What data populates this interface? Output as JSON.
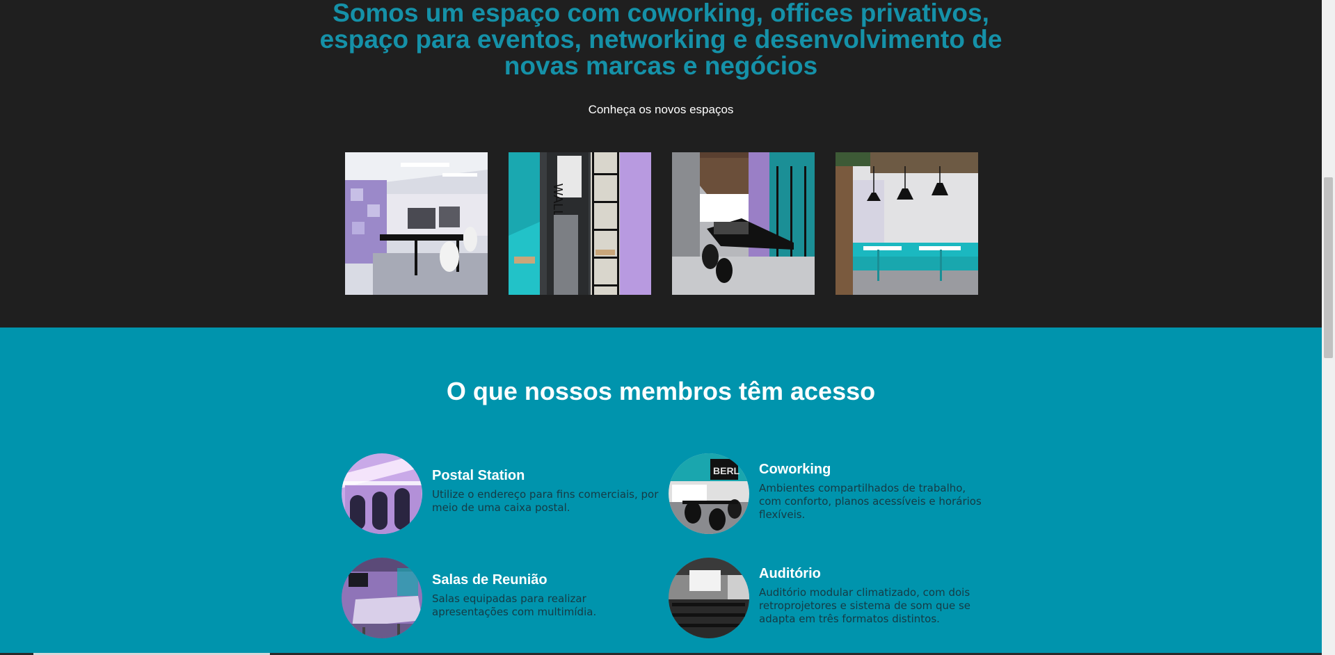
{
  "hero": {
    "title": "Somos um espaço com coworking, offices privativos, espaço para eventos, networking e desenvolvimento de novas marcas e negócios",
    "subtitle": "Conheça os novos espaços"
  },
  "members": {
    "title": "O que nossos membros têm acesso",
    "features": [
      {
        "title": "Postal Station",
        "description": "Utilize o endereço para fins comerciais, por meio de uma caixa postal."
      },
      {
        "title": "Coworking",
        "description": "Ambientes compartilhados de trabalho, com conforto, planos acessíveis e horários flexíveis."
      },
      {
        "title": "Salas de Reunião",
        "description": "Salas equipadas para realizar apresentações com multimídia."
      },
      {
        "title": "Auditório",
        "description": "Auditório modular climatizado, com dois retroprojetores e sistema de som que se adapta em três formatos distintos."
      }
    ]
  },
  "colors": {
    "dark_background": "#1f1f1f",
    "accent_teal": "#1591a8",
    "section_teal": "#0094ad",
    "white": "#ffffff",
    "dark_text": "#153b45"
  }
}
